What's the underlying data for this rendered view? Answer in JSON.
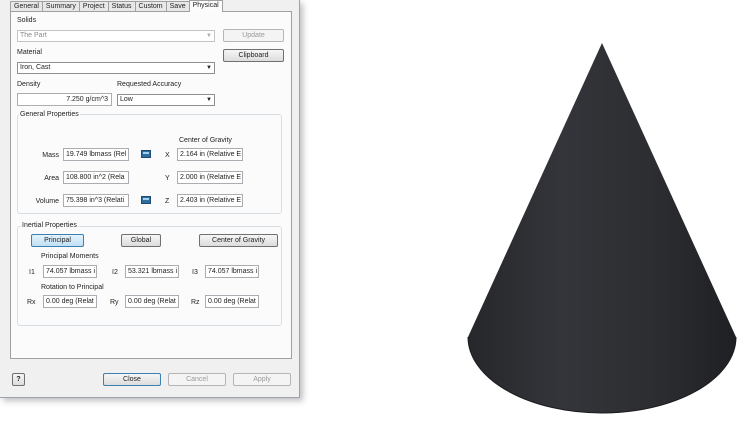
{
  "tabs": [
    "General",
    "Summary",
    "Project",
    "Status",
    "Custom",
    "Save",
    "Physical"
  ],
  "active_tab": "Physical",
  "solids": {
    "label": "Solids",
    "value": "The Part",
    "update_label": "Update",
    "clipboard_label": "Clipboard"
  },
  "material": {
    "label": "Material",
    "value": "Iron, Cast"
  },
  "density": {
    "label": "Density",
    "value": "7.250 g/cm^3"
  },
  "accuracy": {
    "label": "Requested Accuracy",
    "value": "Low"
  },
  "general": {
    "title": "General Properties",
    "cog_label": "Center of Gravity",
    "mass_label": "Mass",
    "mass_value": "19.749 lbmass (Rel",
    "area_label": "Area",
    "area_value": "108.800 in^2 (Rela",
    "volume_label": "Volume",
    "volume_value": "75.398 in^3 (Relati",
    "x_label": "X",
    "x_value": "2.164 in (Relative E",
    "y_label": "Y",
    "y_value": "2.000 in (Relative E",
    "z_label": "Z",
    "z_value": "2.403 in (Relative E"
  },
  "inertial": {
    "title": "Inertial Properties",
    "principal_label": "Principal",
    "global_label": "Global",
    "cog_button_label": "Center of Gravity",
    "moments_label": "Principal Moments",
    "i1_label": "I1",
    "i1_value": "74.057 lbmass i",
    "i2_label": "I2",
    "i2_value": "53.321 lbmass i",
    "i3_label": "I3",
    "i3_value": "74.057 lbmass i",
    "rotation_label": "Rotation to Principal",
    "rx_label": "Rx",
    "rx_value": "0.00 deg (Relat",
    "ry_label": "Ry",
    "ry_value": "0.00 deg (Relat",
    "rz_label": "Rz",
    "rz_value": "0.00 deg (Relat"
  },
  "footer": {
    "help_label": "?",
    "close_label": "Close",
    "cancel_label": "Cancel",
    "apply_label": "Apply"
  },
  "icons": {
    "calculator": "calculator-icon",
    "dropdown": "chevron-down-icon",
    "help": "help-icon"
  },
  "colors": {
    "cone": "#2b2c30",
    "dialog_bg": "#f0f0f0",
    "selected_button": "#bfe0f5"
  }
}
